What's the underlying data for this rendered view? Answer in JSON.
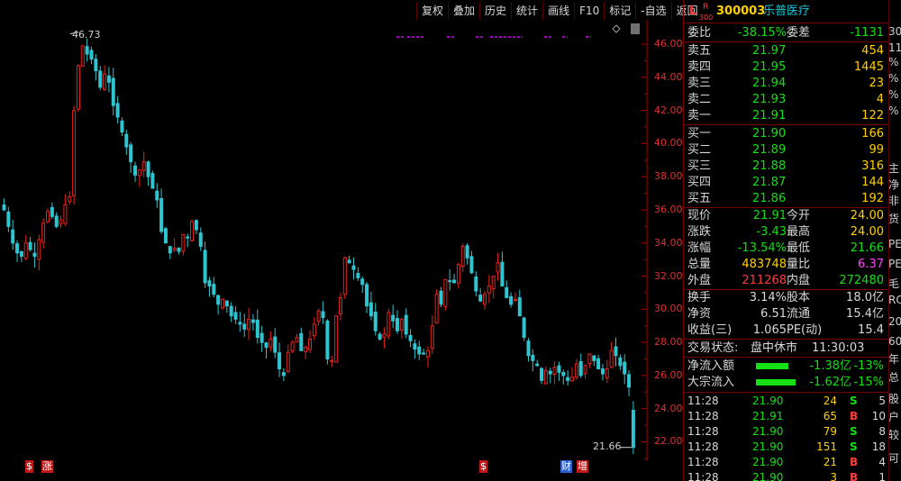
{
  "toolbar": [
    "复权",
    "叠加",
    "历史",
    "统计",
    "画线",
    "F10",
    "标记",
    "-自选",
    "返回"
  ],
  "stock": {
    "code": "300003",
    "name": "乐普医疗",
    "badge_top": "R",
    "badge_bottom": "300",
    "badge_letter": "L"
  },
  "chart": {
    "y_axis": [
      "46.00",
      "44.00",
      "42.00",
      "40.00",
      "38.00",
      "36.00",
      "34.00",
      "32.00",
      "30.00",
      "28.00",
      "26.00",
      "24.00",
      "22.00"
    ],
    "y_min": 21.1,
    "y_max": 47.2,
    "max_label": "46.73",
    "last_label": "21.66",
    "markers": [
      "$",
      "涨",
      "$",
      "财",
      "增"
    ],
    "colors": {
      "up": "#e8221c",
      "down": "#2fc5d0",
      "axis": "#b00000",
      "purple": "#a000c0"
    }
  },
  "chart_data": {
    "type": "candlestick",
    "ylim": [
      21.1,
      47.2
    ],
    "high": 46.73,
    "last": 21.66,
    "closes": [
      36.0,
      35.0,
      34.0,
      33.4,
      33.2,
      34.0,
      33.6,
      33.2,
      34.2,
      35.2,
      35.9,
      35.6,
      35.0,
      35.4,
      36.3,
      36.8,
      42.0,
      44.7,
      45.9,
      45.4,
      45.1,
      44.4,
      43.4,
      44.2,
      43.7,
      42.3,
      41.6,
      40.7,
      39.8,
      38.9,
      38.1,
      38.4,
      38.9,
      38.0,
      37.3,
      36.6,
      34.7,
      34.0,
      33.4,
      33.7,
      33.5,
      34.5,
      34.3,
      35.3,
      34.8,
      33.8,
      31.6,
      31.4,
      30.9,
      30.3,
      30.6,
      30.2,
      29.6,
      29.4,
      29.1,
      28.8,
      29.4,
      29.2,
      28.3,
      28.0,
      27.7,
      28.2,
      27.4,
      26.4,
      26.0,
      27.4,
      28.0,
      28.3,
      27.5,
      27.7,
      28.2,
      29.1,
      29.9,
      29.5,
      27.0,
      26.9,
      29.6,
      30.7,
      33.1,
      32.8,
      32.4,
      31.9,
      31.5,
      30.2,
      29.6,
      28.7,
      28.2,
      28.5,
      29.8,
      29.3,
      28.7,
      29.4,
      28.5,
      28.1,
      27.6,
      27.3,
      27.3,
      27.5,
      29.0,
      30.9,
      30.3,
      31.8,
      31.7,
      31.6,
      32.7,
      33.8,
      33.1,
      32.2,
      31.1,
      30.5,
      30.9,
      31.4,
      32.0,
      32.8,
      31.4,
      30.7,
      30.3,
      30.6,
      29.6,
      28.3,
      27.2,
      26.9,
      26.6,
      25.7,
      26.3,
      26.1,
      26.5,
      26.2,
      26.0,
      25.7,
      25.9,
      26.7,
      26.0,
      26.6,
      27.3,
      26.9,
      26.4,
      26.1,
      26.4,
      27.5,
      27.2,
      26.6,
      26.1,
      25.3,
      21.66
    ],
    "annotations": [
      "46.73",
      "21.66"
    ]
  },
  "quote": {
    "weibi_label": "委比",
    "weibi": "-38.15%",
    "weicha_label": "委差",
    "weicha": "-1131",
    "asks": [
      {
        "label": "卖五",
        "price": "21.97",
        "vol": "454"
      },
      {
        "label": "卖四",
        "price": "21.95",
        "vol": "1445"
      },
      {
        "label": "卖三",
        "price": "21.94",
        "vol": "23"
      },
      {
        "label": "卖二",
        "price": "21.93",
        "vol": "4"
      },
      {
        "label": "卖一",
        "price": "21.91",
        "vol": "122"
      }
    ],
    "bids": [
      {
        "label": "买一",
        "price": "21.90",
        "vol": "166"
      },
      {
        "label": "买二",
        "price": "21.89",
        "vol": "99"
      },
      {
        "label": "买三",
        "price": "21.88",
        "vol": "316"
      },
      {
        "label": "买四",
        "price": "21.87",
        "vol": "144"
      },
      {
        "label": "买五",
        "price": "21.86",
        "vol": "192"
      }
    ],
    "stats": [
      {
        "l1": "现价",
        "v1": "21.91",
        "c1": "green",
        "l2": "今开",
        "v2": "24.00",
        "c2": "yellow"
      },
      {
        "l1": "涨跌",
        "v1": "-3.43",
        "c1": "green",
        "l2": "最高",
        "v2": "24.00",
        "c2": "yellow"
      },
      {
        "l1": "涨幅",
        "v1": "-13.54%",
        "c1": "green",
        "l2": "最低",
        "v2": "21.66",
        "c2": "green"
      },
      {
        "l1": "总量",
        "v1": "483748",
        "c1": "yellow",
        "l2": "量比",
        "v2": "6.37",
        "c2": "mag"
      },
      {
        "l1": "外盘",
        "v1": "211268",
        "c1": "red",
        "l2": "内盘",
        "v2": "272480",
        "c2": "green"
      }
    ],
    "stats2": [
      {
        "l1": "换手",
        "v1": "3.14%",
        "l2": "股本",
        "v2": "18.0亿"
      },
      {
        "l1": "净资",
        "v1": "6.51",
        "l2": "流通",
        "v2": "15.4亿"
      },
      {
        "l1": "收益(三)",
        "v1": "1.065",
        "l2": "PE(动)",
        "v2": "15.4"
      }
    ],
    "status_label": "交易状态:",
    "status": "盘中休市",
    "status_time": "11:30:03",
    "flows": [
      {
        "label": "净流入额",
        "value": "-1.38亿",
        "pct": "-13%",
        "bar": 0.45
      },
      {
        "label": "大宗流入",
        "value": "-1.62亿",
        "pct": "-15%",
        "bar": 0.55
      }
    ],
    "ticks": [
      {
        "time": "11:28",
        "price": "21.90",
        "vol": "24",
        "side": "S",
        "n": "5"
      },
      {
        "time": "11:28",
        "price": "21.91",
        "vol": "65",
        "side": "B",
        "n": "10"
      },
      {
        "time": "11:28",
        "price": "21.90",
        "vol": "79",
        "side": "S",
        "n": "8"
      },
      {
        "time": "11:28",
        "price": "21.90",
        "vol": "151",
        "side": "S",
        "n": "18"
      },
      {
        "time": "11:28",
        "price": "21.90",
        "vol": "21",
        "side": "B",
        "n": "4"
      },
      {
        "time": "11:28",
        "price": "21.90",
        "vol": "3",
        "side": "B",
        "n": "1"
      }
    ]
  },
  "strip": [
    "30",
    "11",
    "%",
    "%",
    "%",
    "%",
    "主",
    "净",
    "非",
    "货",
    "PE",
    "PE",
    "毛",
    "RO",
    "20",
    "60",
    "年",
    "总",
    "股",
    "户",
    "较",
    "可"
  ]
}
